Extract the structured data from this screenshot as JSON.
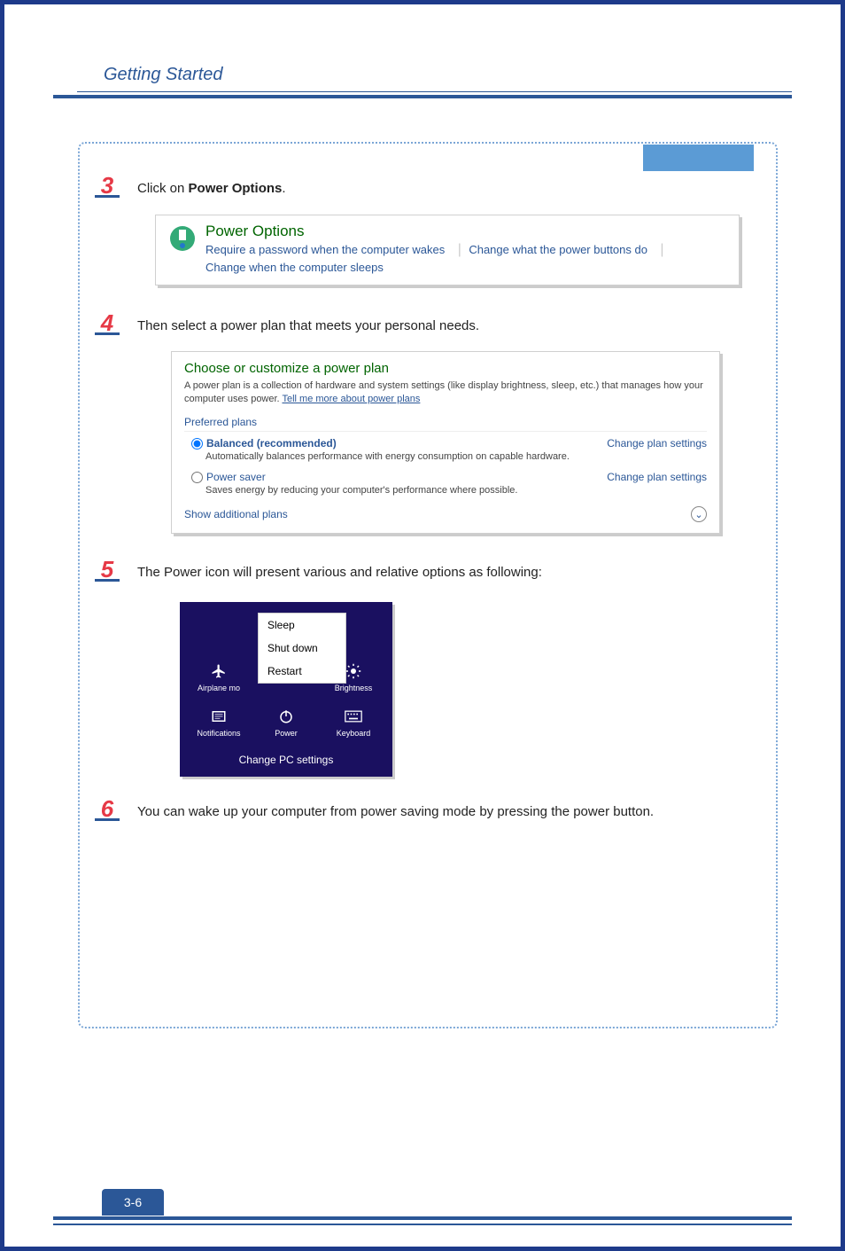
{
  "header": {
    "title": "Getting Started",
    "page_number": "3-6"
  },
  "step3": {
    "num": "3",
    "text_prefix": "Click on ",
    "text_bold": "Power Options",
    "text_suffix": ".",
    "panel": {
      "title": "Power Options",
      "link1": "Require a password when the computer wakes",
      "link2": "Change what the power buttons do",
      "link3": "Change when the computer sleeps"
    }
  },
  "step4": {
    "num": "4",
    "text": "Then select a power plan that meets your personal needs.",
    "panel": {
      "title": "Choose or customize a power plan",
      "desc_a": "A power plan is a collection of hardware and system settings (like display brightness, sleep, etc.) that manages how your computer uses power. ",
      "desc_link": "Tell me more about power plans",
      "preferred": "Preferred plans",
      "plan1": {
        "name": "Balanced (recommended)",
        "cfg": "Change plan settings",
        "sub": "Automatically balances performance with energy consumption on capable hardware."
      },
      "plan2": {
        "name": "Power saver",
        "cfg": "Change plan settings",
        "sub": "Saves energy by reducing your computer's performance where possible."
      },
      "show_additional": "Show additional plans"
    }
  },
  "step5": {
    "num": "5",
    "text": "The Power icon will present various and relative options as following:",
    "menu": {
      "sleep": "Sleep",
      "shutdown": "Shut down",
      "restart": "Restart"
    },
    "row1": {
      "airplane": "Airplane mo",
      "brightness": "Brightness"
    },
    "row2": {
      "notifications": "Notifications",
      "power": "Power",
      "keyboard": "Keyboard"
    },
    "pc": "Change PC settings"
  },
  "step6": {
    "num": "6",
    "text": "You can wake up your computer from power saving mode by pressing the power button."
  }
}
